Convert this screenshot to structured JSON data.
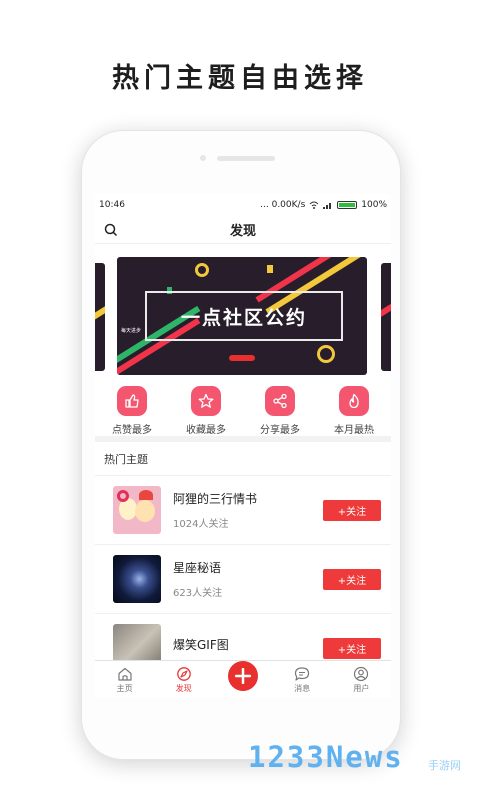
{
  "promo": {
    "title": "热门主题自由选择"
  },
  "statusbar": {
    "time": "10:46",
    "network": "... 0.00K/s",
    "battery": "100%"
  },
  "header": {
    "title": "发现"
  },
  "banner": {
    "text": "一点社区公约",
    "badge": "每天进步"
  },
  "quick_actions": [
    {
      "label": "点赞最多",
      "icon": "thumbs-up-icon"
    },
    {
      "label": "收藏最多",
      "icon": "star-icon"
    },
    {
      "label": "分享最多",
      "icon": "share-icon"
    },
    {
      "label": "本月最热",
      "icon": "flame-icon"
    }
  ],
  "topics": {
    "heading": "热门主题",
    "items": [
      {
        "name": "阿狸的三行情书",
        "followers": "1024人关注",
        "button": "+关注"
      },
      {
        "name": "星座秘语",
        "followers": "623人关注",
        "button": "+关注"
      },
      {
        "name": "爆笑GIF图",
        "followers": "",
        "button": "+关注"
      }
    ]
  },
  "tabbar": {
    "home": "主页",
    "discover": "发现",
    "messages": "消息",
    "user": "用户"
  },
  "watermark": {
    "text": "1233News",
    "suffix": "手游网"
  },
  "colors": {
    "accent": "#e8302e",
    "icon_pink": "#f5566f",
    "banner_bg": "#271d2b"
  }
}
